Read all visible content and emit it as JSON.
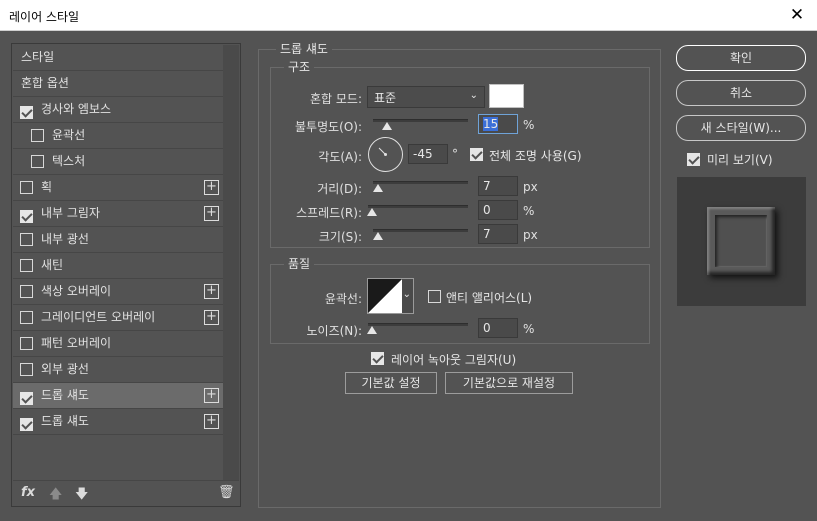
{
  "window": {
    "title": "레이어 스타일",
    "close_glyph": "✕"
  },
  "styles": {
    "items": [
      {
        "label": "스타일",
        "has_check": false,
        "checked": false,
        "sub": false,
        "plus": false,
        "selected": false
      },
      {
        "label": "혼합 옵션",
        "has_check": false,
        "checked": false,
        "sub": false,
        "plus": false,
        "selected": false
      },
      {
        "label": "경사와 엠보스",
        "has_check": true,
        "checked": true,
        "sub": false,
        "plus": false,
        "selected": false
      },
      {
        "label": "윤곽선",
        "has_check": true,
        "checked": false,
        "sub": true,
        "plus": false,
        "selected": false
      },
      {
        "label": "텍스처",
        "has_check": true,
        "checked": false,
        "sub": true,
        "plus": false,
        "selected": false
      },
      {
        "label": "획",
        "has_check": true,
        "checked": false,
        "sub": false,
        "plus": true,
        "selected": false
      },
      {
        "label": "내부 그림자",
        "has_check": true,
        "checked": true,
        "sub": false,
        "plus": true,
        "selected": false
      },
      {
        "label": "내부 광선",
        "has_check": true,
        "checked": false,
        "sub": false,
        "plus": false,
        "selected": false
      },
      {
        "label": "새틴",
        "has_check": true,
        "checked": false,
        "sub": false,
        "plus": false,
        "selected": false
      },
      {
        "label": "색상 오버레이",
        "has_check": true,
        "checked": false,
        "sub": false,
        "plus": true,
        "selected": false
      },
      {
        "label": "그레이디언트 오버레이",
        "has_check": true,
        "checked": false,
        "sub": false,
        "plus": true,
        "selected": false
      },
      {
        "label": "패턴 오버레이",
        "has_check": true,
        "checked": false,
        "sub": false,
        "plus": false,
        "selected": false
      },
      {
        "label": "외부 광선",
        "has_check": true,
        "checked": false,
        "sub": false,
        "plus": false,
        "selected": false
      },
      {
        "label": "드롭 섀도",
        "has_check": true,
        "checked": true,
        "sub": false,
        "plus": true,
        "selected": true
      },
      {
        "label": "드롭 섀도",
        "has_check": true,
        "checked": true,
        "sub": false,
        "plus": true,
        "selected": false
      }
    ],
    "tools": {
      "fx": "fx",
      "up": "🡅",
      "down": "🡇",
      "trash": "🗑"
    }
  },
  "section_title": "드롭 섀도",
  "structure": {
    "legend": "구조",
    "blend_mode_label": "혼합 모드:",
    "blend_mode_value": "표준",
    "shadow_color": "#ffffff",
    "opacity_label": "불투명도(O):",
    "opacity_value": "15",
    "opacity_unit": "%",
    "opacity_fraction": 0.15,
    "angle_label": "각도(A):",
    "angle_value": "-45",
    "angle_unit": "°",
    "global_light_label": "전체 조명 사용(G)",
    "global_light_checked": true,
    "distance_label": "거리(D):",
    "distance_value": "7",
    "distance_unit": "px",
    "spread_label": "스프레드(R):",
    "spread_value": "0",
    "spread_unit": "%",
    "size_label": "크기(S):",
    "size_value": "7",
    "size_unit": "px"
  },
  "quality": {
    "legend": "품질",
    "contour_label": "윤곽선:",
    "antialias_label": "앤티 앨리어스(L)",
    "antialias_checked": false,
    "noise_label": "노이즈(N):",
    "noise_value": "0",
    "noise_unit": "%"
  },
  "knockout_label": "레이어 녹아웃 그림자(U)",
  "knockout_checked": true,
  "make_default": "기본값 설정",
  "reset_default": "기본값으로 재설정",
  "buttons": {
    "ok": "확인",
    "cancel": "취소",
    "new_style": "새 스타일(W)..."
  },
  "preview": {
    "label": "미리 보기(V)",
    "checked": true
  }
}
